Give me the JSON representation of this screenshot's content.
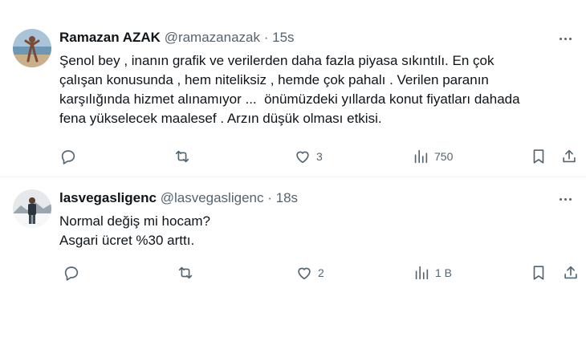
{
  "tweets": [
    {
      "name": "Ramazan AZAK",
      "handle": "@ramazanazak",
      "separator": "·",
      "time": "15s",
      "text_lines": [
        "Şenol bey , inanın grafik ve verilerden daha fazla piyasa sıkıntılı. En çok",
        "çalışan konusunda , hem niteliksiz , hemde çok pahalı . Verilen paranın",
        "karşılığında hizmet alınamıyor ...  önümüzdeki yıllarda konut fiyatları dahada",
        "fena yükselecek maalesef . Arzın düşük olması etkisi."
      ],
      "likes": "3",
      "views": "750"
    },
    {
      "name": "lasvegasligenc",
      "handle": "@lasvegasligenc",
      "separator": "·",
      "time": "18s",
      "text_lines": [
        "Normal değiş mi hocam?",
        "Asgari ücret %30 arttı."
      ],
      "likes": "2",
      "views": "1 B"
    }
  ],
  "icons": [
    "reply-icon",
    "retweet-icon",
    "like-icon",
    "views-icon",
    "bookmark-icon",
    "share-icon",
    "more-icon"
  ],
  "colors": {
    "text": "#0f1419",
    "secondary": "#536471",
    "divider": "#eff3f4"
  }
}
